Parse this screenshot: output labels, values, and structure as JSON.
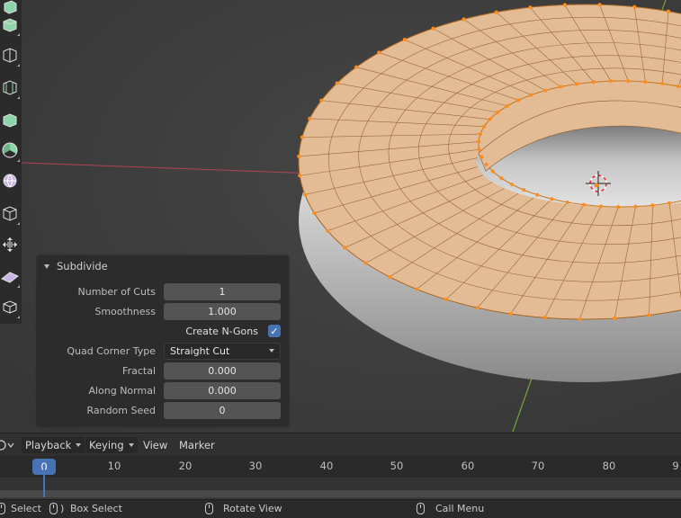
{
  "operator_panel": {
    "title": "Subdivide",
    "rows": {
      "number_of_cuts": {
        "label": "Number of Cuts",
        "value": "1"
      },
      "smoothness": {
        "label": "Smoothness",
        "value": "1.000"
      },
      "create_ngons": {
        "label": "Create N-Gons",
        "checked": true
      },
      "quad_corner_type": {
        "label": "Quad Corner Type",
        "value": "Straight Cut"
      },
      "fractal": {
        "label": "Fractal",
        "value": "0.000"
      },
      "along_normal": {
        "label": "Along Normal",
        "value": "0.000"
      },
      "random_seed": {
        "label": "Random Seed",
        "value": "0"
      }
    }
  },
  "timeline": {
    "menus": {
      "playback": "Playback",
      "keying": "Keying",
      "view": "View",
      "marker": "Marker"
    },
    "current_frame": "0",
    "ticks": [
      "10",
      "20",
      "30",
      "40",
      "50",
      "60",
      "70",
      "80",
      "9"
    ]
  },
  "statusbar": {
    "select": "Select",
    "box_select": "Box Select",
    "rotate_view": "Rotate View",
    "call_menu": "Call Menu"
  },
  "toolbar": {
    "tools": [
      "extrude-region-icon",
      "inset-faces-icon",
      "bevel-icon",
      "loop-cut-icon",
      "knife-icon",
      "poly-build-icon",
      "spin-icon",
      "smooth-vertices-icon",
      "edge-slide-icon",
      "shrink-fatten-icon",
      "shear-icon",
      "rip-region-icon"
    ]
  },
  "colors": {
    "accent": "#4772b3",
    "mesh_face": "#e8c4a0",
    "vertex": "#ff8c1a",
    "x_axis": "#c24a5a",
    "y_axis": "#7aa43a"
  }
}
